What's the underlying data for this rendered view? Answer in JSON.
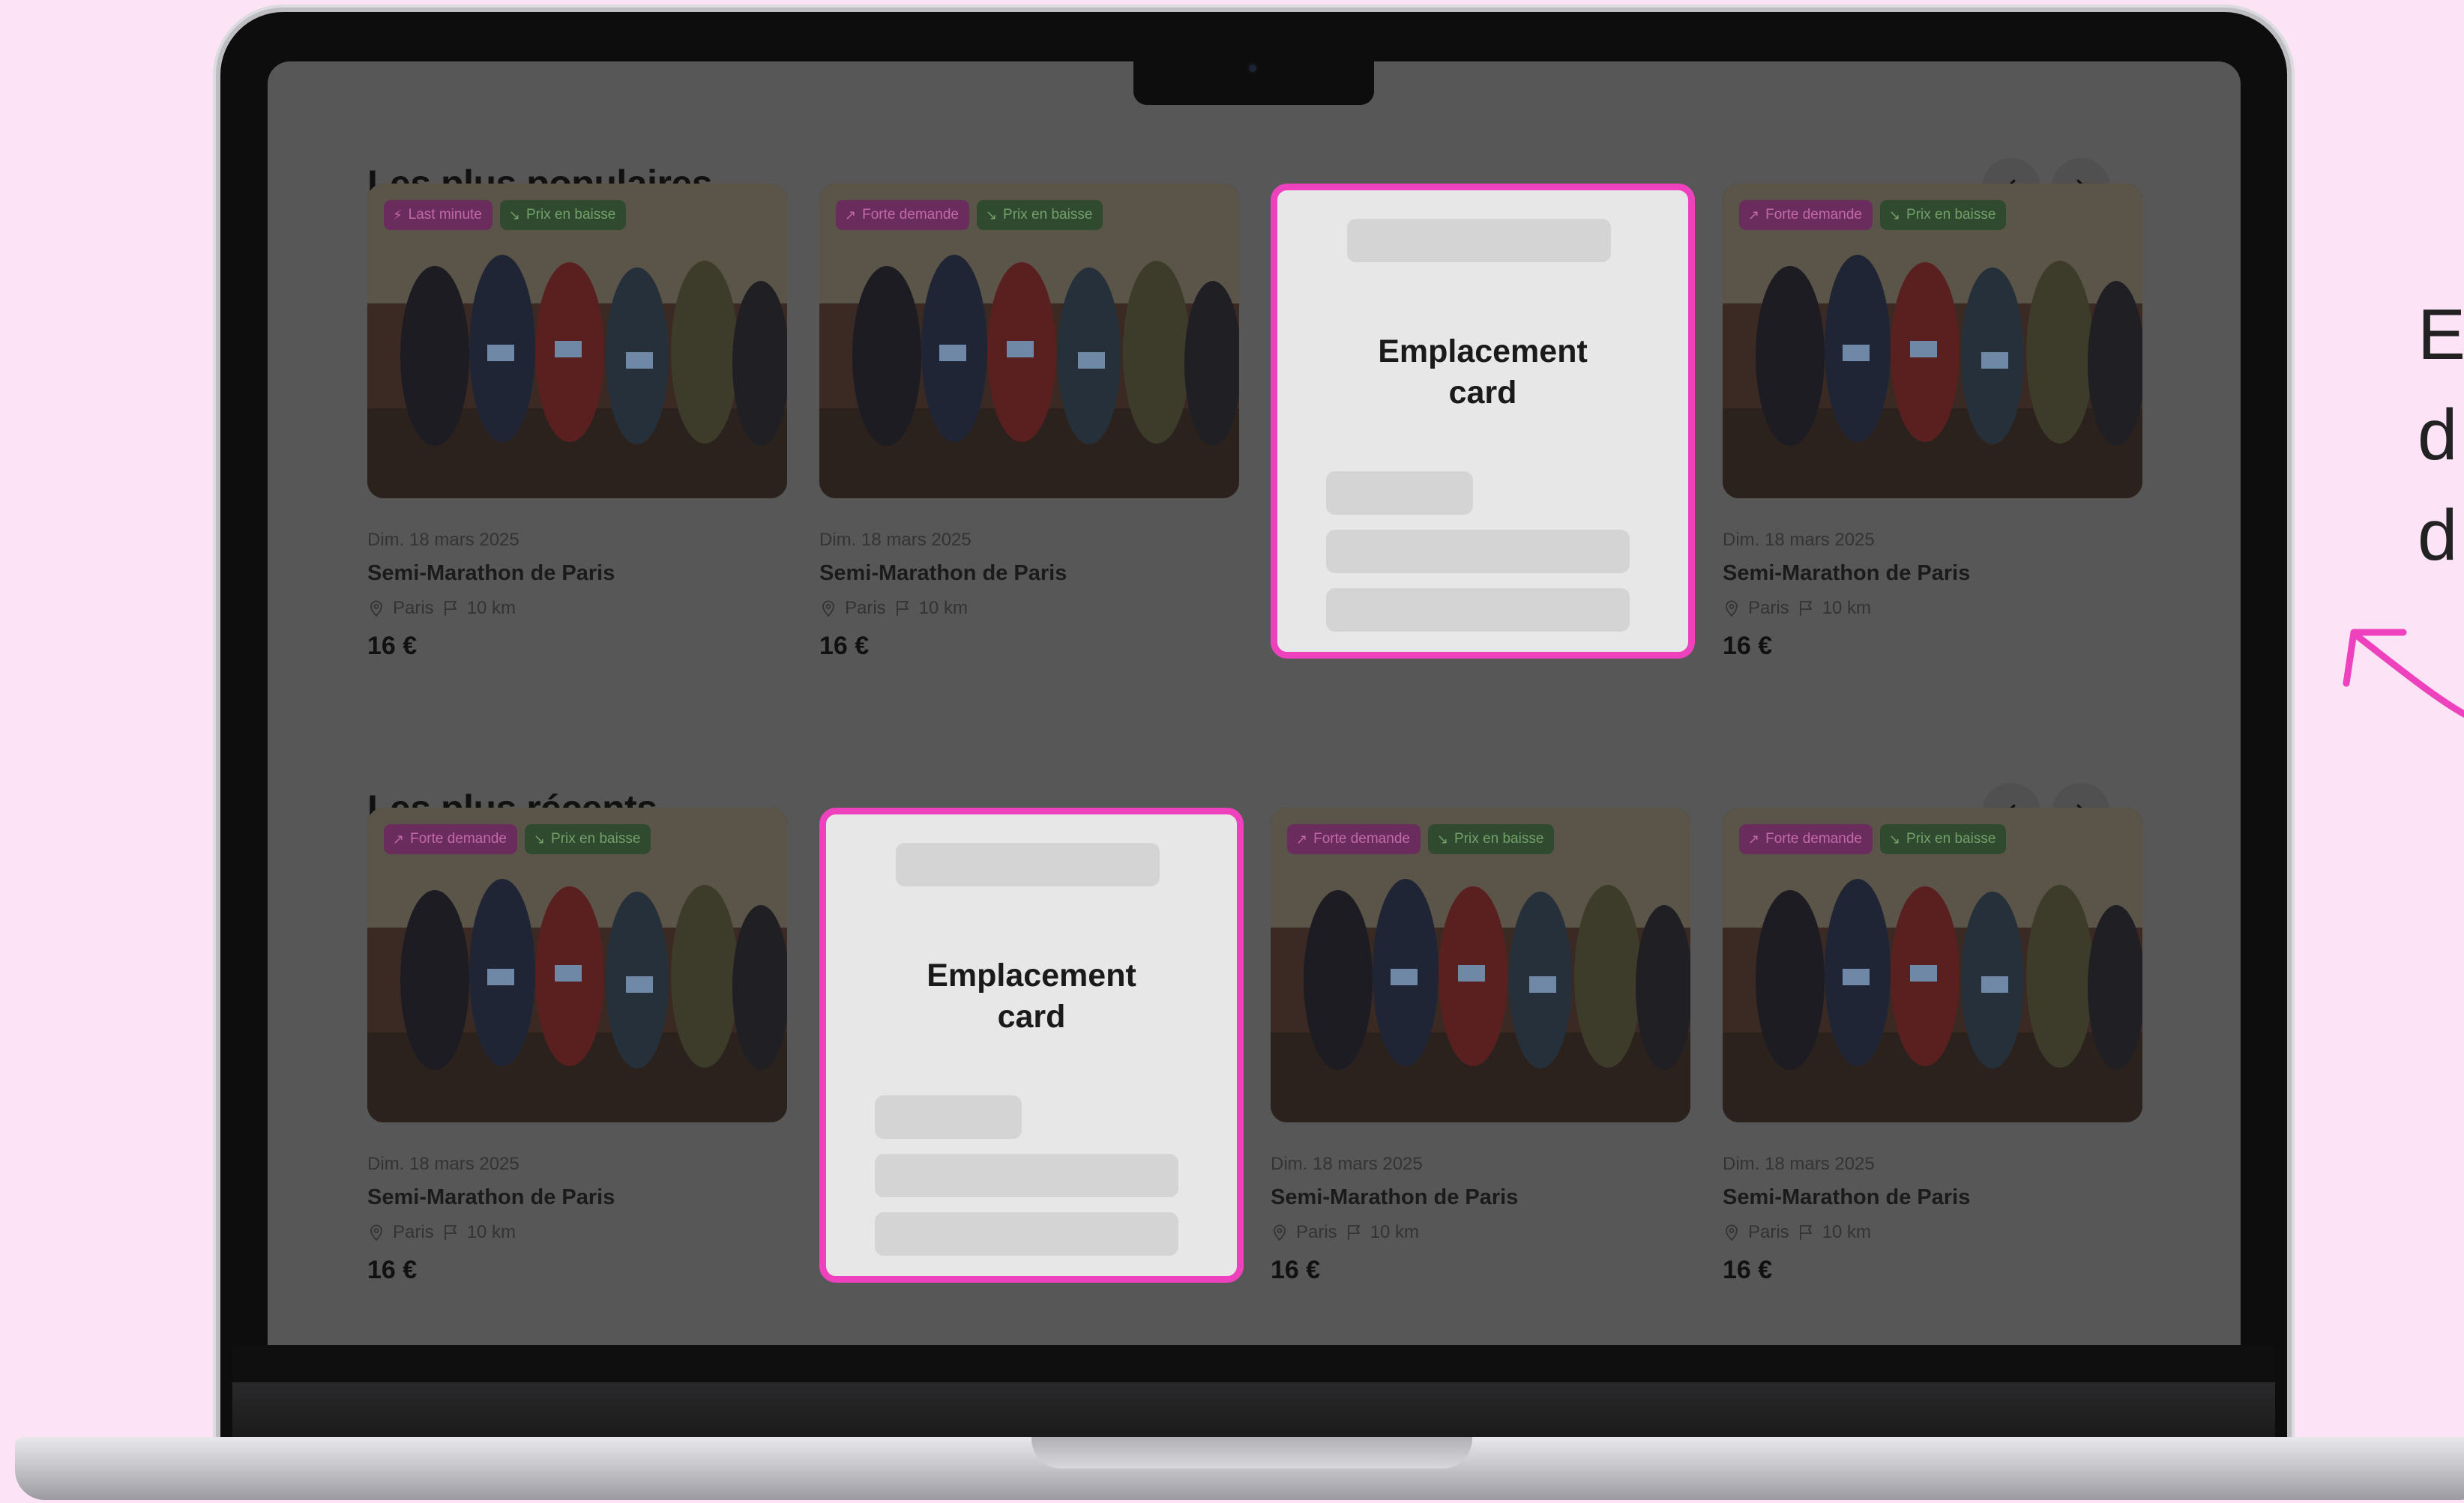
{
  "sections": [
    {
      "title": "Les plus populaires",
      "cards": [
        {
          "type": "event",
          "badges": [
            {
              "icon": "⚡",
              "label": "Last minute",
              "style": "pink"
            },
            {
              "icon": "↘",
              "label": "Prix en baisse",
              "style": "green"
            }
          ],
          "date": "Dim. 18 mars 2025",
          "name": "Semi-Marathon de Paris",
          "city": "Paris",
          "distance": "10 km",
          "price": "16 €"
        },
        {
          "type": "event",
          "badges": [
            {
              "icon": "↗",
              "label": "Forte demande",
              "style": "pink"
            },
            {
              "icon": "↘",
              "label": "Prix en baisse",
              "style": "green"
            }
          ],
          "date": "Dim. 18 mars 2025",
          "name": "Semi-Marathon de Paris",
          "city": "Paris",
          "distance": "10 km",
          "price": "16 €"
        },
        {
          "type": "placeholder",
          "label_line1": "Emplacement",
          "label_line2": "card"
        },
        {
          "type": "event",
          "badges": [
            {
              "icon": "↗",
              "label": "Forte demande",
              "style": "pink"
            },
            {
              "icon": "↘",
              "label": "Prix en baisse",
              "style": "green"
            }
          ],
          "date": "Dim. 18 mars 2025",
          "name": "Semi-Marathon de Paris",
          "city": "Paris",
          "distance": "10 km",
          "price": "16 €"
        }
      ]
    },
    {
      "title": "Les plus récents",
      "cards": [
        {
          "type": "event",
          "badges": [
            {
              "icon": "↗",
              "label": "Forte demande",
              "style": "pink"
            },
            {
              "icon": "↘",
              "label": "Prix en baisse",
              "style": "green"
            }
          ],
          "date": "Dim. 18 mars 2025",
          "name": "Semi-Marathon de Paris",
          "city": "Paris",
          "distance": "10 km",
          "price": "16 €"
        },
        {
          "type": "placeholder",
          "label_line1": "Emplacement",
          "label_line2": "card"
        },
        {
          "type": "event",
          "badges": [
            {
              "icon": "↗",
              "label": "Forte demande",
              "style": "pink"
            },
            {
              "icon": "↘",
              "label": "Prix en baisse",
              "style": "green"
            }
          ],
          "date": "Dim. 18 mars 2025",
          "name": "Semi-Marathon de Paris",
          "city": "Paris",
          "distance": "10 km",
          "price": "16 €"
        },
        {
          "type": "event",
          "badges": [
            {
              "icon": "↗",
              "label": "Forte demande",
              "style": "pink"
            },
            {
              "icon": "↘",
              "label": "Prix en baisse",
              "style": "green"
            }
          ],
          "date": "Dim. 18 mars 2025",
          "name": "Semi-Marathon de Paris",
          "city": "Paris",
          "distance": "10 km",
          "price": "16 €"
        }
      ]
    }
  ],
  "nav": {
    "prev_icon": "chevron-left-icon",
    "next_icon": "chevron-right-icon"
  },
  "side_note": {
    "visible_text": "E\nd\nd"
  },
  "colors": {
    "background": "#fce4f6",
    "highlight": "#ee41bd",
    "screen_overlay": "#575757"
  }
}
